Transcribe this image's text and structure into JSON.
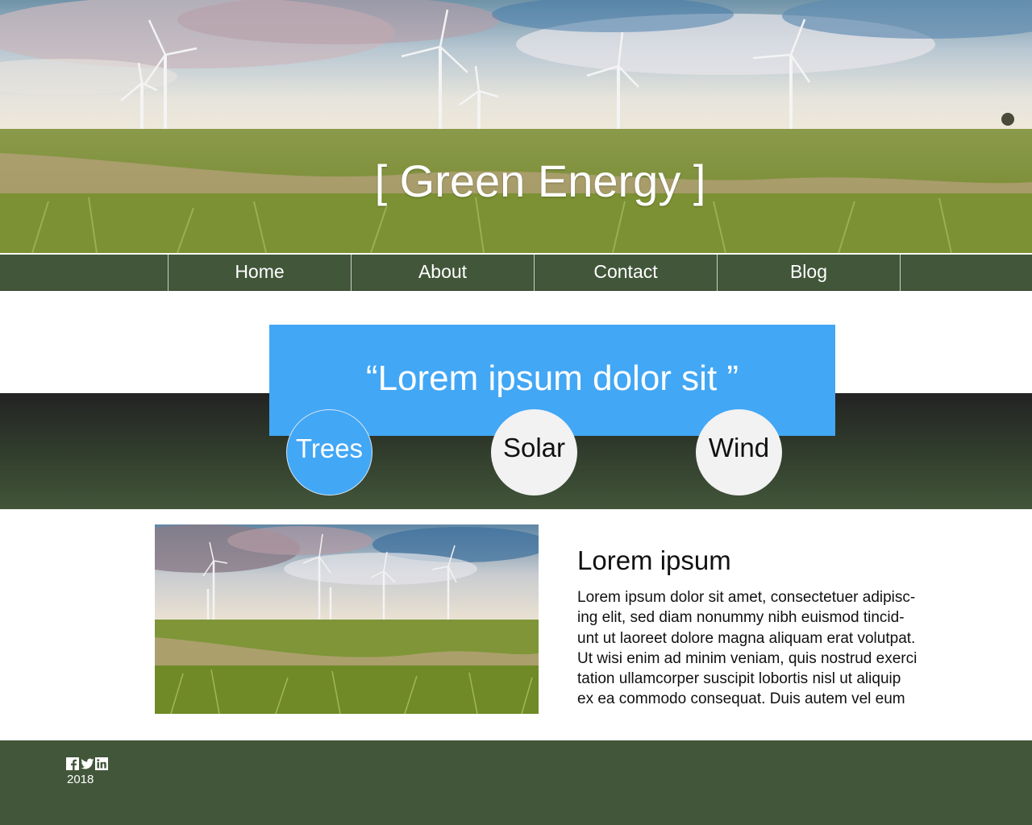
{
  "hero": {
    "title": "[ Green Energy ]"
  },
  "nav": {
    "items": [
      {
        "label": "Home"
      },
      {
        "label": "About"
      },
      {
        "label": "Contact"
      },
      {
        "label": "Blog"
      }
    ]
  },
  "feature": {
    "quote": "“Lorem ipsum dolor sit ”",
    "circles": [
      {
        "label": "Trees",
        "active": true
      },
      {
        "label": "Solar",
        "active": false
      },
      {
        "label": "Wind",
        "active": false
      }
    ]
  },
  "article": {
    "title": "Lorem ipsum",
    "lines": [
      "Lorem ipsum dolor sit amet, consectetuer adipisc-",
      "ing elit, sed diam nonummy nibh euismod tincid-",
      "unt ut laoreet dolore magna aliquam erat volutpat.",
      "Ut wisi enim ad minim veniam, quis nostrud exerci",
      "tation ullamcorper suscipit lobortis nisl ut aliquip",
      "ex ea commodo consequat. Duis autem vel eum"
    ]
  },
  "footer": {
    "social_icons": [
      "facebook-icon",
      "twitter-icon",
      "linkedin-icon"
    ],
    "year": "2018"
  },
  "colors": {
    "nav_green": "#42563a",
    "accent_blue": "#42a7f5",
    "circle_grey": "#f2f2f2"
  }
}
